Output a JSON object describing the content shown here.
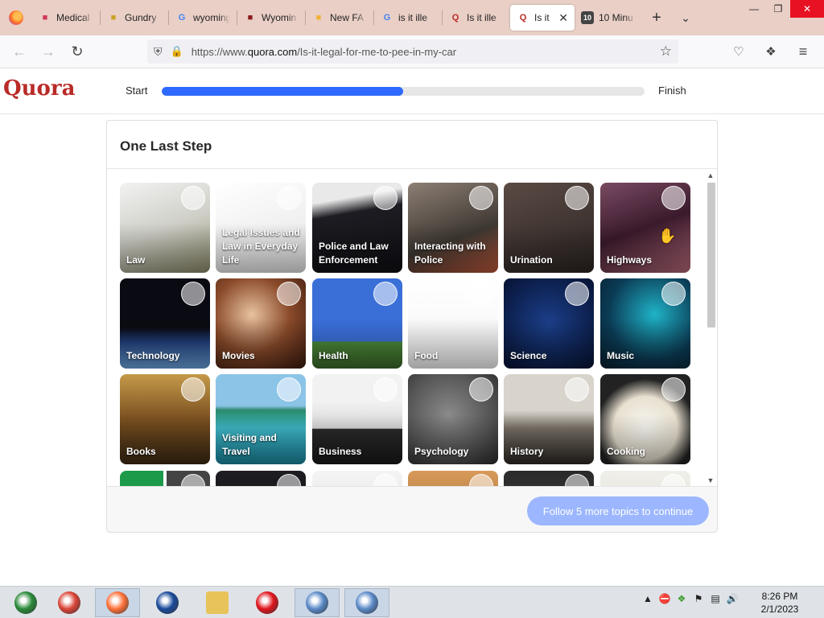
{
  "browser": {
    "tabs": [
      {
        "title": "Medical",
        "icon": "medical-icon",
        "icon_color": "#d2355a"
      },
      {
        "title": "Gundry",
        "icon": "gundry-icon",
        "icon_color": "#c9a227"
      },
      {
        "title": "wyoming",
        "icon": "google-icon",
        "icon_color": "#4285f4"
      },
      {
        "title": "Wyomin",
        "icon": "wyoming-site-icon",
        "icon_color": "#8b1a1a"
      },
      {
        "title": "New FA",
        "icon": "new-fa-icon",
        "icon_color": "#f2b134"
      },
      {
        "title": "is it ille",
        "icon": "google-icon",
        "icon_color": "#4285f4"
      },
      {
        "title": "Is it ille",
        "icon": "quora-icon",
        "icon_color": "#b92b27"
      },
      {
        "title": "Is it",
        "icon": "quora-icon",
        "icon_color": "#b92b27",
        "active": true
      },
      {
        "title": "10 Minu",
        "icon": "ten-minute-icon",
        "icon_color": "#444444"
      }
    ],
    "url_prefix": "https://www.",
    "url_host": "quora.com",
    "url_path": "/Is-it-legal-for-me-to-pee-in-my-car"
  },
  "quora": {
    "logo": "Quora",
    "start_label": "Start",
    "finish_label": "Finish",
    "progress_fraction": 0.5,
    "accent_color": "#2e69ff",
    "brand_color": "#b92b27"
  },
  "modal": {
    "title": "One Last Step",
    "cta_label": "Follow 5 more topics to continue",
    "topics": [
      {
        "label": "Law",
        "bg": "linear-gradient(160deg,#f2f2f2,#cfcfc8 50%,#8b8b6a)",
        "motif": "scale"
      },
      {
        "label": "Legal Issues and Law in Everyday Life",
        "bg": "linear-gradient(160deg,#ffffff,#e4e4e4)",
        "motif": "justice"
      },
      {
        "label": "Police and Law Enforcement",
        "bg": "linear-gradient(170deg,#e9e9e9 0 20%,#1c1c22 35%,#0f0f14)",
        "motif": "helmet"
      },
      {
        "label": "Interacting with Police",
        "bg": "linear-gradient(160deg,#8d7f74,#3e3832 60%,#c0593b)",
        "motif": "people"
      },
      {
        "label": "Urination",
        "bg": "linear-gradient(160deg,#5a4a44,#2b2422)",
        "motif": "sign"
      },
      {
        "label": "Highways",
        "bg": "linear-gradient(160deg,#7a4b63,#3a1a2c 50%,#b76a7a)",
        "motif": "road"
      },
      {
        "label": "Technology",
        "bg": "linear-gradient(180deg,#0a0a12 0 55%,#1f3e7a 70%,#6ea6e0)",
        "motif": "astronaut"
      },
      {
        "label": "Movies",
        "bg": "radial-gradient(circle at 40% 40%,#e8c2a0,#8a4a2a 50%,#3a1a0e)",
        "motif": "reel"
      },
      {
        "label": "Health",
        "bg": "linear-gradient(180deg,#3a6fd8 0 70%,#4c8a3a 70%,#3b6a2a)",
        "motif": "person"
      },
      {
        "label": "Food",
        "bg": "linear-gradient(180deg,#ffffff,#f4f4f4)",
        "motif": "burger"
      },
      {
        "label": "Science",
        "bg": "radial-gradient(circle at 50% 50%,#1b3f8a,#061233)",
        "motif": "dna"
      },
      {
        "label": "Music",
        "bg": "radial-gradient(circle at 60% 40%,#1fb3c7,#0b3b55 60%,#06202e)",
        "motif": "mic"
      },
      {
        "label": "Books",
        "bg": "linear-gradient(180deg,#c59a4a,#7a5020 50%,#3d2a14)",
        "motif": "books"
      },
      {
        "label": "Visiting and Travel",
        "bg": "linear-gradient(180deg,#8cc4e8 0 35%,#2a8a6a 40%,#3fb8c8 60%,#1a88a0)",
        "motif": "island"
      },
      {
        "label": "Business",
        "bg": "linear-gradient(180deg,#f2f2f2 0 30%,#d6d6d6 60%,#2a2a2a 61%,#1a1a1a)",
        "motif": "suits"
      },
      {
        "label": "Psychology",
        "bg": "radial-gradient(circle at 45% 45%,#8a8a8a,#555 60%,#2a2a2a)",
        "motif": "head"
      },
      {
        "label": "History",
        "bg": "linear-gradient(180deg,#d8d4cc 0 40%,#7a7268 60%,#2e2a25)",
        "motif": "harbor"
      },
      {
        "label": "Cooking",
        "bg": "radial-gradient(circle at 50% 60%,#f8f8f2,#e8e0d0 45%,#222 70%)",
        "motif": "salad"
      },
      {
        "label": "",
        "bg": "linear-gradient(90deg,#1c9a4a 0 48%,#fff 48% 52%,#444 52%)",
        "motif": "sign2"
      },
      {
        "label": "",
        "bg": "linear-gradient(180deg,#1e1e22,#0f0f12)",
        "motif": "dark"
      },
      {
        "label": "",
        "bg": "linear-gradient(180deg,#f4f4f4,#dcdcdc)",
        "motif": "grid"
      },
      {
        "label": "",
        "bg": "linear-gradient(180deg,#d89a5a,#8a5a2a)",
        "motif": "warm"
      },
      {
        "label": "",
        "bg": "linear-gradient(180deg,#2a2a2a,#4a4a4a)",
        "motif": "chalk"
      },
      {
        "label": "",
        "bg": "linear-gradient(180deg,#f0f0ea,#d6d6c8)",
        "motif": "plate"
      }
    ]
  },
  "taskbar": {
    "apps": [
      {
        "name": "windows-start-icon",
        "color": "#2a8a3a"
      },
      {
        "name": "chrome-icon",
        "color": "#db4437"
      },
      {
        "name": "firefox-icon",
        "color": "#ff7139",
        "active": true
      },
      {
        "name": "obama-icon",
        "color": "#1a4a9a"
      },
      {
        "name": "file-explorer-icon",
        "color": "#e8c35a"
      },
      {
        "name": "opera-icon",
        "color": "#e0151d"
      },
      {
        "name": "network-app-icon",
        "color": "#5a8ac8",
        "active": true
      },
      {
        "name": "network-app-icon-2",
        "color": "#5a8ac8",
        "active": true
      }
    ],
    "time": "8:26 PM",
    "date": "2/1/2023"
  }
}
